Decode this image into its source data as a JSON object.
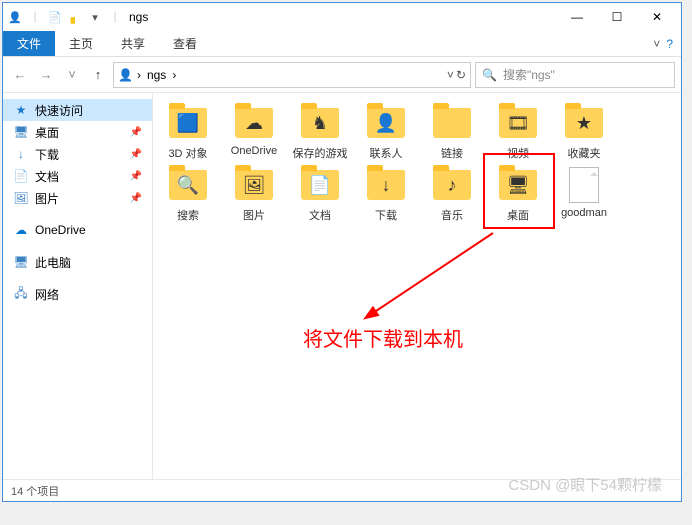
{
  "titlebar": {
    "title": "ngs"
  },
  "wincontrols": {
    "min": "—",
    "max": "☐",
    "close": "✕"
  },
  "ribbon": {
    "file": "文件",
    "tabs": [
      "主页",
      "共享",
      "查看"
    ],
    "help": "?"
  },
  "nav": {
    "back": "←",
    "fwd": "→",
    "dropdown": "˅",
    "up": "↑",
    "crumbs": [
      "ngs"
    ],
    "refresh": "↻",
    "search_placeholder": "搜索\"ngs\""
  },
  "sidebar": {
    "quick": {
      "label": "快速访问",
      "icon": "★"
    },
    "items": [
      {
        "label": "桌面",
        "icon": "🖥",
        "color": "#3b82c4",
        "pinned": true
      },
      {
        "label": "下载",
        "icon": "↓",
        "color": "#3b82c4",
        "pinned": true
      },
      {
        "label": "文档",
        "icon": "📄",
        "color": "#3b82c4",
        "pinned": true
      },
      {
        "label": "图片",
        "icon": "🖼",
        "color": "#3b82c4",
        "pinned": true
      }
    ],
    "onedrive": {
      "label": "OneDrive",
      "icon": "☁",
      "color": "#0078d4"
    },
    "thispc": {
      "label": "此电脑",
      "icon": "🖥",
      "color": "#3b82c4"
    },
    "network": {
      "label": "网络",
      "icon": "🖧",
      "color": "#3b82c4"
    }
  },
  "folders_row1": [
    {
      "label": "3D 对象",
      "overlay": "🟦"
    },
    {
      "label": "OneDrive",
      "overlay": "☁"
    },
    {
      "label": "保存的游戏",
      "overlay": "♞"
    },
    {
      "label": "联系人",
      "overlay": "👤"
    },
    {
      "label": "链接",
      "overlay": ""
    },
    {
      "label": "视频",
      "overlay": "🎞"
    },
    {
      "label": "收藏夹",
      "overlay": "★"
    },
    {
      "label": "搜索",
      "overlay": "🔍"
    }
  ],
  "folders_row2": [
    {
      "label": "图片",
      "overlay": "🖼"
    },
    {
      "label": "文档",
      "overlay": "📄"
    },
    {
      "label": "下载",
      "overlay": "↓"
    },
    {
      "label": "音乐",
      "overlay": "♪"
    },
    {
      "label": "桌面",
      "overlay": "🖥"
    }
  ],
  "file_item": {
    "label": "goodman"
  },
  "annotation": "将文件下载到本机",
  "status": "14 个项目",
  "watermark": "CSDN @眼下54颗柠檬"
}
